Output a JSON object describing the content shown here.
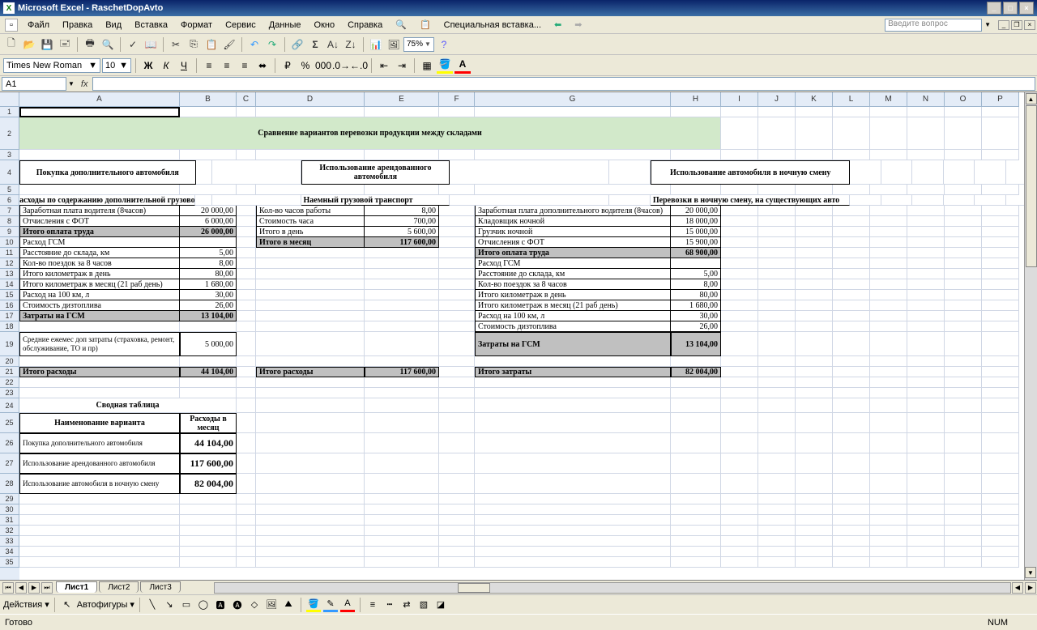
{
  "app": {
    "title": "Microsoft Excel - RaschetDopAvto"
  },
  "menu": {
    "file": "Файл",
    "edit": "Правка",
    "view": "Вид",
    "insert": "Вставка",
    "format": "Формат",
    "tools": "Сервис",
    "data": "Данные",
    "window": "Окно",
    "help": "Справка",
    "special_paste": "Специальная вставка...",
    "qprompt": "Введите вопрос"
  },
  "format": {
    "font": "Times New Roman",
    "size": "10",
    "zoom": "75%"
  },
  "namebox": "A1",
  "columns": [
    "A",
    "B",
    "C",
    "D",
    "E",
    "F",
    "G",
    "H",
    "I",
    "J",
    "K",
    "L",
    "M",
    "N",
    "O",
    "P"
  ],
  "rows": [
    "1",
    "2",
    "3",
    "4",
    "5",
    "6",
    "7",
    "8",
    "9",
    "10",
    "11",
    "12",
    "13",
    "14",
    "15",
    "16",
    "17",
    "18",
    "19",
    "20",
    "21",
    "22",
    "23",
    "24",
    "25",
    "26",
    "27",
    "28",
    "29",
    "30",
    "31",
    "32",
    "33",
    "34",
    "35"
  ],
  "sheets": [
    "Лист1",
    "Лист2",
    "Лист3"
  ],
  "drawbar": {
    "actions": "Действия",
    "autoshapes": "Автофигуры"
  },
  "status": {
    "ready": "Готово",
    "num": "NUM"
  },
  "doc": {
    "title_merged": "Сравнение вариантов перевозки продукции между складами",
    "col1": {
      "header": "Покупка дополнительного автомобиля",
      "sub": "Расходы по содержанию дополнительной грузовой",
      "rows": [
        {
          "l": "Заработная плата водителя (8часов)",
          "v": "20 000,00"
        },
        {
          "l": "Отчисления с ФОТ",
          "v": "6 000,00"
        },
        {
          "l": "Итого оплата труда",
          "v": "26 000,00",
          "gray": true,
          "bold": true
        },
        {
          "l": "Расход ГСМ",
          "v": ""
        },
        {
          "l": "Расстояние до склада, км",
          "v": "5,00"
        },
        {
          "l": "Кол-во поездок за 8 часов",
          "v": "8,00"
        },
        {
          "l": "Итого километраж в день",
          "v": "80,00"
        },
        {
          "l": "Итого километраж в месяц (21 раб день)",
          "v": "1 680,00"
        },
        {
          "l": "Расход на 100 км, л",
          "v": "30,00"
        },
        {
          "l": "Стоимость дизтоплива",
          "v": "26,00"
        },
        {
          "l": "Затраты на ГСМ",
          "v": "13 104,00",
          "gray": true,
          "bold": true
        }
      ],
      "extra": {
        "l": "Средние ежемес доп затраты (страховка, ремонт, обслуживание, ТО и пр)",
        "v": "5 000,00"
      },
      "total": {
        "l": "Итого расходы",
        "v": "44 104,00"
      }
    },
    "col2": {
      "header": "Использование арендованного автомобиля",
      "sub": "Наемный грузовой транспорт",
      "rows": [
        {
          "l": "Кол-во часов работы",
          "v": "8,00"
        },
        {
          "l": "Стоимость часа",
          "v": "700,00"
        },
        {
          "l": "Итого в день",
          "v": "5 600,00"
        },
        {
          "l": "Итого в месяц",
          "v": "117 600,00",
          "gray": true,
          "bold": true
        }
      ],
      "total": {
        "l": "Итого расходы",
        "v": "117 600,00"
      }
    },
    "col3": {
      "header": "Использование автомобиля в ночную смену",
      "sub": "Перевозки в ночную смену, на существующих авто",
      "rows": [
        {
          "l": "Заработная плата дополнительного водителя (8часов)",
          "v": "20 000,00"
        },
        {
          "l": "Кладовщик ночной",
          "v": "18 000,00"
        },
        {
          "l": "Грузчик ночной",
          "v": "15 000,00"
        },
        {
          "l": "Отчисления с ФОТ",
          "v": "15 900,00"
        },
        {
          "l": "Итого оплата труда",
          "v": "68 900,00",
          "gray": true,
          "bold": true
        },
        {
          "l": "Расход ГСМ",
          "v": ""
        },
        {
          "l": "Расстояние до склада, км",
          "v": "5,00"
        },
        {
          "l": "Кол-во поездок за 8 часов",
          "v": "8,00"
        },
        {
          "l": "Итого километраж в день",
          "v": "80,00"
        },
        {
          "l": "Итого километраж в месяц (21 раб день)",
          "v": "1 680,00"
        },
        {
          "l": "Расход на 100 км, л",
          "v": "30,00"
        },
        {
          "l": "Стоимость дизтоплива",
          "v": "26,00"
        },
        {
          "l": "Затраты на ГСМ",
          "v": "13 104,00",
          "gray": true,
          "bold": true
        }
      ],
      "total": {
        "l": "Итого затраты",
        "v": "82 004,00"
      }
    },
    "summary": {
      "title": "Сводная таблица",
      "h1": "Наименование варианта",
      "h2": "Расходы в месяц",
      "rows": [
        {
          "l": "Покупка дополнительного автомобиля",
          "v": "44 104,00"
        },
        {
          "l": "Использование арендованного автомобиля",
          "v": "117 600,00"
        },
        {
          "l": "Использование автомобиля в ночную смену",
          "v": "82 004,00"
        }
      ]
    }
  }
}
